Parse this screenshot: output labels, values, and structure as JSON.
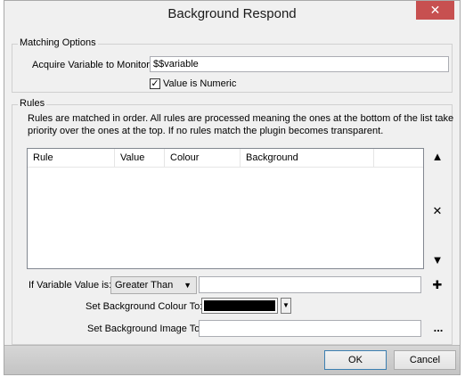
{
  "window": {
    "title": "Background Respond",
    "close_glyph": "✕"
  },
  "matching_options": {
    "group_title": "Matching Options",
    "acquire_label": "Acquire Variable to Monitor:",
    "acquire_value": "$$variable",
    "numeric_checked": true,
    "numeric_label": "Value is Numeric"
  },
  "rules": {
    "group_title": "Rules",
    "description_line1": "Rules are matched in order.  All rules are processed meaning the ones at the bottom of the list take",
    "description_line2": "priority over the ones at the top.  If no rules match the plugin becomes transparent.",
    "columns": [
      "Rule",
      "Value",
      "Colour",
      "Background"
    ],
    "rows": [],
    "move_up_icon": "▲",
    "delete_icon": "✕",
    "move_down_icon": "▼",
    "add_icon": "✚",
    "browse_label": "..."
  },
  "rule_editor": {
    "if_value_label": "If Variable Value is:",
    "comparison_selected": "Greater Than",
    "value_input": "",
    "set_colour_label": "Set Background Colour To:",
    "colour_value": "#000000",
    "set_image_label": "Set Background Image To:",
    "image_input": ""
  },
  "footer": {
    "ok_label": "OK",
    "cancel_label": "Cancel"
  }
}
